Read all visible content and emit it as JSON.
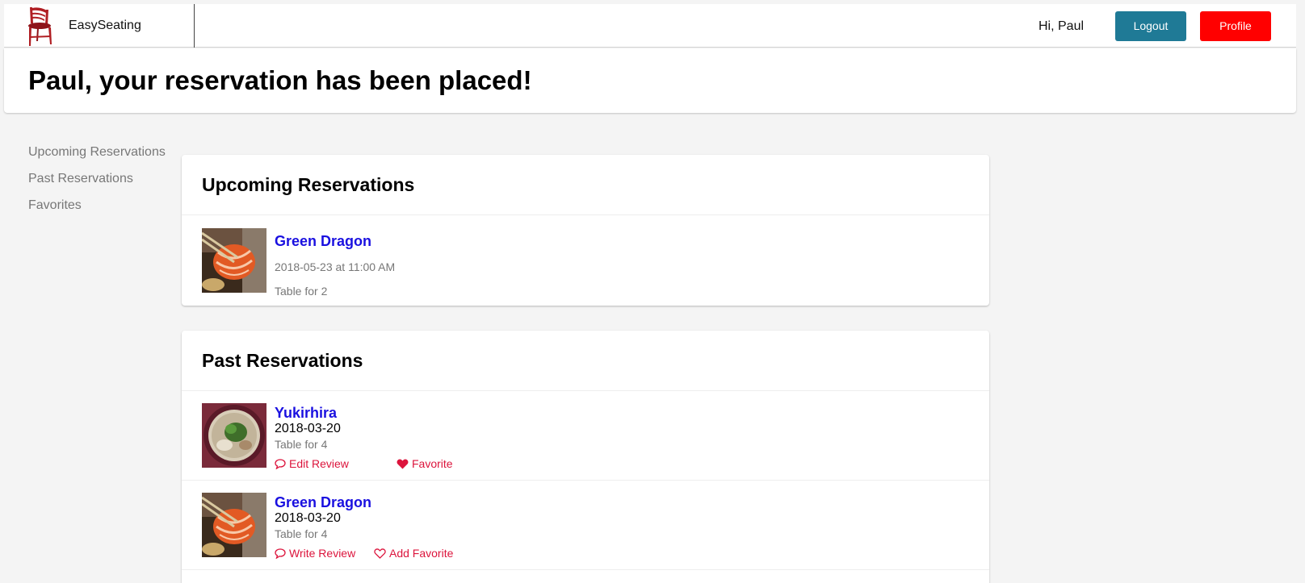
{
  "navbar": {
    "brand_name": "EasySeating",
    "greeting": "Hi, Paul",
    "logout_label": "Logout",
    "profile_label": "Profile"
  },
  "banner": {
    "title": "Paul, your reservation has been placed!"
  },
  "sidenav": {
    "items": [
      {
        "label": "Upcoming Reservations"
      },
      {
        "label": "Past Reservations"
      },
      {
        "label": "Favorites"
      }
    ]
  },
  "upcoming": {
    "heading": "Upcoming Reservations",
    "items": [
      {
        "restaurant": "Green Dragon",
        "datetime": "2018-05-23 at 11:00 AM",
        "party": "Table for 2",
        "image": "salmon-sushi-photo"
      }
    ]
  },
  "past": {
    "heading": "Past Reservations",
    "items": [
      {
        "restaurant": "Yukirhira",
        "date": "2018-03-20",
        "party": "Table for 4",
        "review_label": "Edit Review",
        "favorite_label": "Favorite",
        "favorited": true,
        "image": "ramen-bowl-photo"
      },
      {
        "restaurant": "Green Dragon",
        "date": "2018-03-20",
        "party": "Table for 4",
        "review_label": "Write Review",
        "favorite_label": "Add Favorite",
        "favorited": false,
        "image": "salmon-sushi-photo"
      }
    ]
  },
  "colors": {
    "logout_button": "#1f7a96",
    "profile_button": "#ff0000",
    "restaurant_link": "#1a10e0",
    "action_link": "#dc143c",
    "page_background": "#f4f4f4"
  },
  "icons": {
    "brand": "chair-icon",
    "review": "comment-icon",
    "favorite_filled": "heart-filled-icon",
    "favorite_outline": "heart-outline-icon"
  }
}
